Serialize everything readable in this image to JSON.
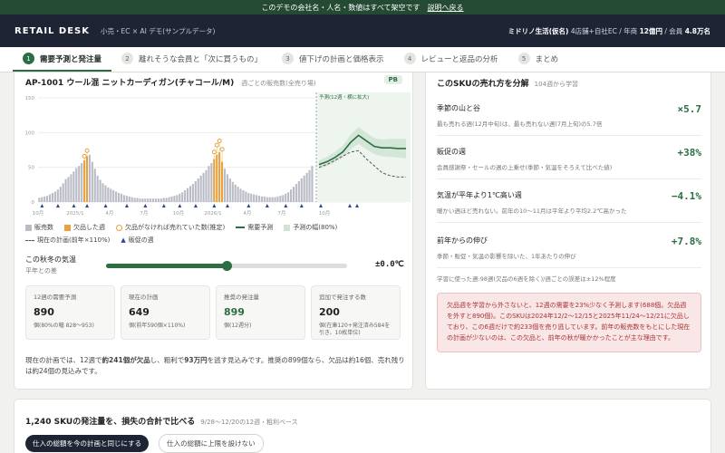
{
  "banner": {
    "text": "このデモの会社名・人名・数値はすべて架空です",
    "link": "説明へ戻る"
  },
  "header": {
    "brand": "RETAIL DESK",
    "subtitle": "小売・EC × AI デモ(サンプルデータ)",
    "company": "ミドリノ生活(仮名)",
    "company_info": "4店舗+自社EC / 年商 ",
    "revenue": "12億円",
    "members_label": " / 会員 ",
    "members": "4.8万名"
  },
  "tabs": [
    {
      "num": "1",
      "label": "需要予測と発注量"
    },
    {
      "num": "2",
      "label": "離れそうな会員と「次に買うもの」"
    },
    {
      "num": "3",
      "label": "値下げの計画と価格表示"
    },
    {
      "num": "4",
      "label": "レビューと返品の分析"
    },
    {
      "num": "5",
      "label": "まとめ"
    }
  ],
  "left": {
    "title": "AP-1001 ウール混 ニットカーディガン(チャコール/M)",
    "subtitle": "週ごとの販売数(全売り場)",
    "badge": "PB",
    "forecast_label": "予測(12週・横に拡大)",
    "legend": [
      "販売数",
      "欠品した週",
      "欠品がなければ売れていた数(推定)",
      "需要予測",
      "予測の幅(80%)",
      "現在の計画(前年×110%)",
      "販促の週"
    ],
    "slider_label": "この秋冬の気温",
    "slider_sub": "平年との差",
    "slider_value": "±0.0℃",
    "kpis": [
      {
        "label": "12週の需要予測",
        "value": "890",
        "sub": "個(80%の幅 828〜953)"
      },
      {
        "label": "現在の計画",
        "value": "649",
        "sub": "個(前年590個×110%)"
      },
      {
        "label": "推奨の発注量",
        "value": "899",
        "sub": "個(12週分)"
      },
      {
        "label": "追加で発注する数",
        "value": "200",
        "sub": "個(在庫120+発注済み584を引き、10枚単位)"
      }
    ],
    "summary_1": "現在の計画では、12週で",
    "summary_2": "約241個が欠品",
    "summary_3": "し、粗利で",
    "summary_4": "93万円",
    "summary_5": "を逃す見込みです。推奨の899個なら、欠品は約16個、売れ残りは約24個の見込みです。"
  },
  "right": {
    "title": "このSKUの売れ方を分解",
    "subtitle": "104週から学習",
    "metrics": [
      {
        "label": "季節の山と谷",
        "desc": "最も売れる週(12月中旬)は、最も売れない週(7月上旬)の5.7倍",
        "value": "×5.7"
      },
      {
        "label": "販促の週",
        "desc": "会員感謝祭・セールの週の上乗せ(季節・気温をそろえて比べた値)",
        "value": "+38%"
      },
      {
        "label": "気温が平年より1℃高い週",
        "desc": "暖かい週ほど売れない。前年の10〜11月は平年より平均2.2℃高かった",
        "value": "−4.1%"
      },
      {
        "label": "前年からの伸び",
        "desc": "季節・販促・気温の影響を除いた、1年あたりの伸び",
        "value": "+7.8%"
      }
    ],
    "footnote": "学習に使った週:98週(欠品の6週を除く)/週ごとの誤差は±12%程度",
    "note": "欠品週を学習から外さないと、12週の需要を23%少なく予測します(688個。欠品週を外すと890個)。このSKUは2024年12/2〜12/15と2025年11/24〜12/21に欠品しており、この6週だけで約233個を売り逃しています。前年の販売数をもとにした現在の計画が少ないのは、この欠品と、前年の秋が暖かかったことが主な理由です。"
  },
  "bottom": {
    "title": "1,240 SKUの発注量を、損失の合計で比べる",
    "subtitle": "9/28〜12/20の12週・粗利ベース",
    "btn1": "仕入の総額を今の計画と同じにする",
    "btn2": "仕入の総額に上限を設けない"
  },
  "chart_data": {
    "type": "bar",
    "title": "AP-1001 ウール混 ニットカーディガン(チャコール/M)",
    "ylim": [
      0,
      150
    ],
    "yticks": [
      "150",
      "100",
      "50",
      "0"
    ],
    "xticks": [
      "10月",
      "2025/1",
      "4月",
      "7月",
      "10月",
      "2026/1",
      "4月",
      "7月",
      "10月"
    ],
    "colors": {
      "sales": "#b9bcc6",
      "stockout": "#e7a23f",
      "forecast": "#2d6d43",
      "band": "#cfe4d4",
      "plan": "#555555"
    },
    "weekly_sales": [
      6,
      7,
      8,
      9,
      11,
      13,
      15,
      18,
      22,
      27,
      33,
      36,
      40,
      44,
      49,
      52,
      56,
      60,
      66,
      68,
      58,
      48,
      38,
      32,
      27,
      24,
      21,
      19,
      17,
      15,
      13,
      12,
      10,
      9,
      8,
      7,
      6,
      6,
      5,
      5,
      5,
      5,
      5,
      5,
      5,
      5,
      5,
      6,
      6,
      7,
      8,
      9,
      10,
      12,
      14,
      17,
      20,
      23,
      26,
      30,
      34,
      38,
      42,
      46,
      52,
      56,
      62,
      68,
      72,
      58,
      48,
      40,
      34,
      29,
      25,
      22,
      19,
      17,
      15,
      13,
      12,
      11,
      10,
      9,
      8,
      8,
      7,
      7,
      7,
      7,
      8,
      9,
      10,
      12,
      14,
      18,
      22,
      26,
      30,
      34,
      38,
      42,
      46,
      52
    ],
    "stockout_weeks": [
      17,
      18,
      66,
      67,
      68,
      69
    ],
    "stockout_estimated_extra": [
      6,
      8,
      10,
      14,
      16,
      18
    ],
    "promo_weeks": [
      1,
      7,
      13,
      18,
      25,
      33,
      40,
      47,
      53,
      59,
      66,
      71,
      79,
      86,
      93,
      99,
      104,
      108,
      109
    ],
    "forecast": [
      54,
      58,
      64,
      72,
      86,
      96,
      88,
      80,
      78,
      78,
      77,
      77
    ],
    "forecast_low": [
      48,
      52,
      57,
      64,
      76,
      84,
      76,
      69,
      66,
      65,
      64,
      63
    ],
    "forecast_high": [
      60,
      65,
      72,
      81,
      97,
      108,
      100,
      92,
      90,
      91,
      91,
      91
    ],
    "plan": [
      50,
      54,
      60,
      66,
      72,
      74,
      62,
      52,
      42,
      38,
      36,
      36
    ]
  }
}
